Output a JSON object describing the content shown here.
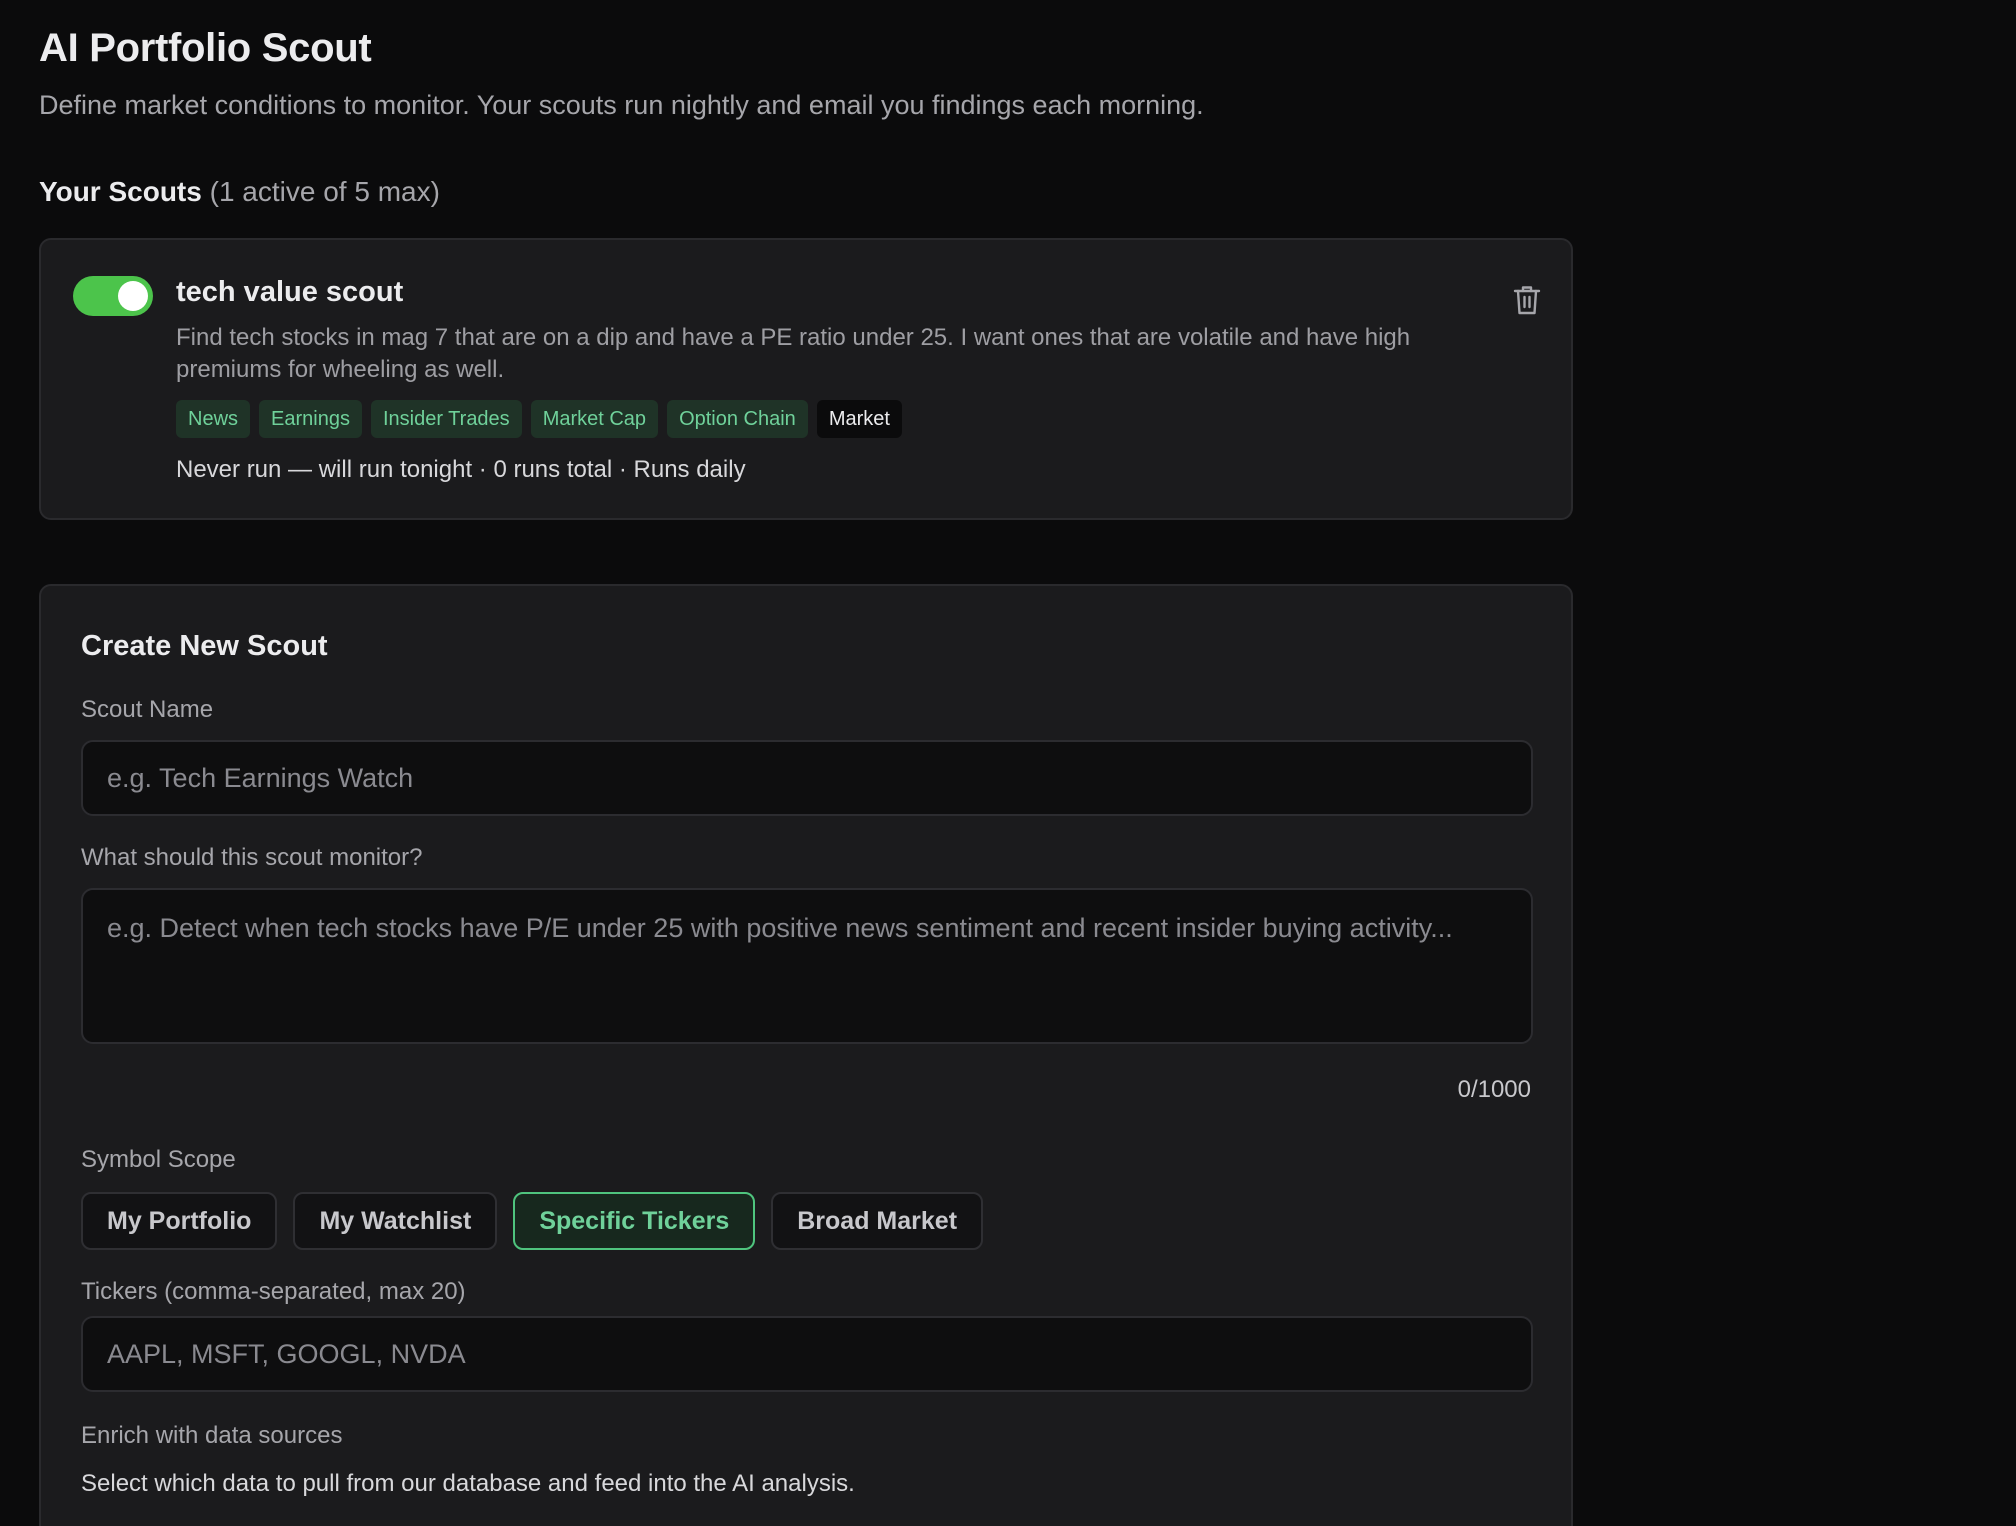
{
  "header": {
    "title": "AI Portfolio Scout",
    "subtitle": "Define market conditions to monitor. Your scouts run nightly and email you findings each morning."
  },
  "scouts_section": {
    "heading": "Your Scouts",
    "count_text": "(1 active of 5 max)"
  },
  "scouts": [
    {
      "enabled": true,
      "name": "tech value scout",
      "description": "Find tech stocks in mag 7 that are on a dip and have a PE ratio under 25. I want ones that are volatile and have high premiums for wheeling as well.",
      "tags": [
        "News",
        "Earnings",
        "Insider Trades",
        "Market Cap",
        "Option Chain",
        "Market"
      ],
      "status": "Never run — will run tonight · 0 runs total · Runs daily"
    }
  ],
  "create_form": {
    "title": "Create New Scout",
    "name_label": "Scout Name",
    "name_placeholder": "e.g. Tech Earnings Watch",
    "monitor_label": "What should this scout monitor?",
    "monitor_placeholder": "e.g. Detect when tech stocks have P/E under 25 with positive news sentiment and recent insider buying activity...",
    "char_counter": "0/1000",
    "scope_label": "Symbol Scope",
    "scope_options": [
      "My Portfolio",
      "My Watchlist",
      "Specific Tickers",
      "Broad Market"
    ],
    "scope_selected": "Specific Tickers",
    "tickers_label": "Tickers (comma-separated, max 20)",
    "tickers_placeholder": "AAPL, MSFT, GOOGL, NVDA",
    "enrich_label": "Enrich with data sources",
    "enrich_help": "Select which data to pull from our database and feed into the AI analysis."
  },
  "colors": {
    "accent_green": "#4cc44b",
    "tag_text_green": "#6fd19a",
    "background": "#0b0b0c",
    "card": "#1b1b1d"
  },
  "icons": {
    "delete": "trash-icon"
  }
}
